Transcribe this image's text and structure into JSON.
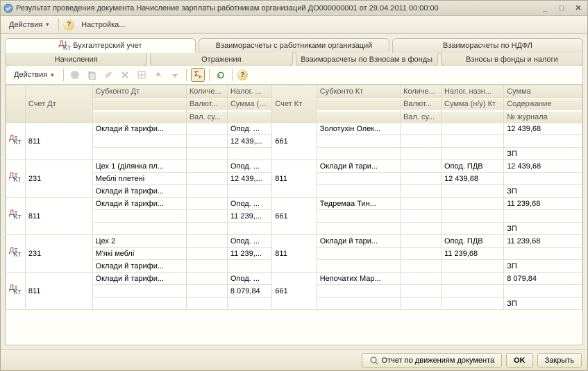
{
  "window": {
    "title": "Результат проведения документа Начисление зарплаты работникам организаций ДО000000001 от 29.04.2011 00:00:00"
  },
  "menubar": {
    "actions": "Действия",
    "settings": "Настройка..."
  },
  "tabs_row1": {
    "t0": "Бухгалтерский учет",
    "t1": "Взаиморасчеты с работниками организаций",
    "t2": "Взаиморасчеты по НДФЛ"
  },
  "tabs_row2": {
    "t0": "Начисления",
    "t1": "Отражения",
    "t2": "Взаиморасчеты по Взносам в фонды",
    "t3": "Взносы в фонды и налоги"
  },
  "toolbar": {
    "actions": "Действия"
  },
  "headers": {
    "r0": {
      "acc_dt": "Счет Дт",
      "sub_dt": "Субконто Дт",
      "qty_dt": "Количе...",
      "tax_dt": "Налог. ...",
      "acc_kt": "Счет Кт",
      "sub_kt": "Субконто Кт",
      "qty_kt": "Количе...",
      "tax_kt": "Налог. назн...",
      "sum": "Сумма"
    },
    "r1": {
      "cur_dt": "Валют...",
      "sum_nu_dt": "Сумма (н/у) Дт",
      "cur_kt": "Валют...",
      "sum_nu_kt": "Сумма (н/у) Кт",
      "content": "Содержание"
    },
    "r2": {
      "val_dt": "Вал. су...",
      "val_kt": "Вал. су...",
      "journal": "№ журнала"
    }
  },
  "rows": [
    {
      "acc_dt": "811",
      "sub_dt_1": "Оклади й тарифи...",
      "sub_dt_2": "",
      "sub_dt_3": "",
      "tax_1": "Опод. ...",
      "tax_2": "12 439,...",
      "acc_kt": "661",
      "sub_kt_1": "Золотухін Олек...",
      "sub_kt_2": "",
      "sub_kt_3": "",
      "tax_kt_1": "",
      "tax_kt_2": "",
      "sum_1": "12 439,68",
      "sum_2": "",
      "sum_3": "ЗП"
    },
    {
      "acc_dt": "231",
      "sub_dt_1": "Цех 1 (ділянка пл...",
      "sub_dt_2": "Меблі плетені",
      "sub_dt_3": "Оклади й тарифи...",
      "tax_1": "Опод. ...",
      "tax_2": "12 439,...",
      "acc_kt": "811",
      "sub_kt_1": "Оклади й тари...",
      "sub_kt_2": "",
      "sub_kt_3": "",
      "tax_kt_1": "Опод. ПДВ",
      "tax_kt_2": "12 439,68",
      "sum_1": "12 439,68",
      "sum_2": "",
      "sum_3": "ЗП"
    },
    {
      "acc_dt": "811",
      "sub_dt_1": "Оклади й тарифи...",
      "sub_dt_2": "",
      "sub_dt_3": "",
      "tax_1": "Опод. ...",
      "tax_2": "11 239,...",
      "acc_kt": "661",
      "sub_kt_1": "Тедремаа Тин...",
      "sub_kt_2": "",
      "sub_kt_3": "",
      "tax_kt_1": "",
      "tax_kt_2": "",
      "sum_1": "11 239,68",
      "sum_2": "",
      "sum_3": "ЗП"
    },
    {
      "acc_dt": "231",
      "sub_dt_1": "Цех 2",
      "sub_dt_2": "М'які меблі",
      "sub_dt_3": "Оклади й тарифи...",
      "tax_1": "Опод. ...",
      "tax_2": "11 239,...",
      "acc_kt": "811",
      "sub_kt_1": "Оклади й тари...",
      "sub_kt_2": "",
      "sub_kt_3": "",
      "tax_kt_1": "Опод. ПДВ",
      "tax_kt_2": "11 239,68",
      "sum_1": "11 239,68",
      "sum_2": "",
      "sum_3": "ЗП"
    },
    {
      "acc_dt": "811",
      "sub_dt_1": "Оклади й тарифи...",
      "sub_dt_2": "",
      "sub_dt_3": "",
      "tax_1": "Опод. ...",
      "tax_2": "8 079,84",
      "acc_kt": "661",
      "sub_kt_1": "Непочатих Мар...",
      "sub_kt_2": "",
      "sub_kt_3": "",
      "tax_kt_1": "",
      "tax_kt_2": "",
      "sum_1": "8 079,84",
      "sum_2": "",
      "sum_3": "ЗП"
    }
  ],
  "footer": {
    "report": "Отчет по движениям документа",
    "ok": "OK",
    "close": "Закрыть"
  }
}
